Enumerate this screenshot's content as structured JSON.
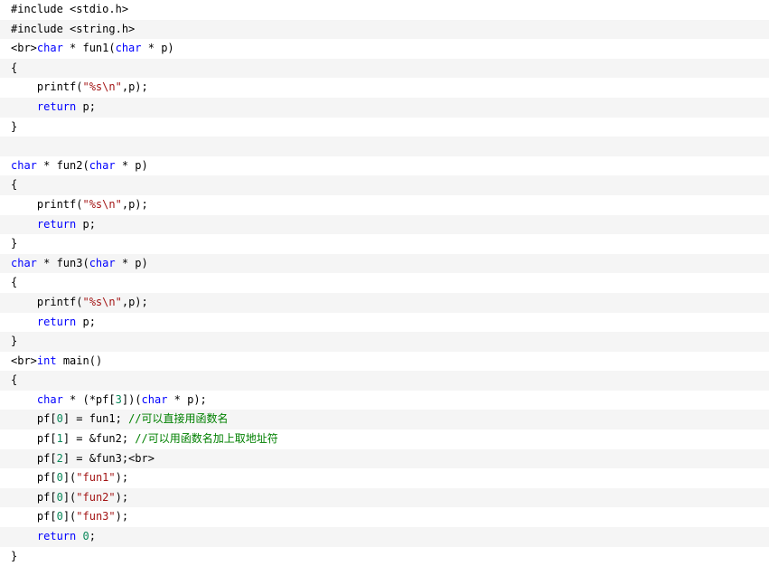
{
  "colors": {
    "background": "#ffffff",
    "stripe": "#f5f5f5",
    "keyword": "#0000ff",
    "string": "#a31515",
    "number": "#09885a",
    "comment": "#008000",
    "plain": "#000000"
  },
  "code": {
    "lines": [
      [
        {
          "t": "plain",
          "v": "#include <stdio.h>"
        }
      ],
      [
        {
          "t": "plain",
          "v": "#include <string.h>"
        }
      ],
      [
        {
          "t": "plain",
          "v": "<br>"
        },
        {
          "t": "kw",
          "v": "char"
        },
        {
          "t": "plain",
          "v": " * fun1("
        },
        {
          "t": "kw",
          "v": "char"
        },
        {
          "t": "plain",
          "v": " * p)"
        }
      ],
      [
        {
          "t": "plain",
          "v": "{"
        }
      ],
      [
        {
          "t": "plain",
          "v": "    printf("
        },
        {
          "t": "str",
          "v": "\"%s\\n\""
        },
        {
          "t": "plain",
          "v": ",p);"
        }
      ],
      [
        {
          "t": "plain",
          "v": "    "
        },
        {
          "t": "kw",
          "v": "return"
        },
        {
          "t": "plain",
          "v": " p;"
        }
      ],
      [
        {
          "t": "plain",
          "v": "}"
        }
      ],
      [
        {
          "t": "plain",
          "v": ""
        }
      ],
      [
        {
          "t": "kw",
          "v": "char"
        },
        {
          "t": "plain",
          "v": " * fun2("
        },
        {
          "t": "kw",
          "v": "char"
        },
        {
          "t": "plain",
          "v": " * p)"
        }
      ],
      [
        {
          "t": "plain",
          "v": "{"
        }
      ],
      [
        {
          "t": "plain",
          "v": "    printf("
        },
        {
          "t": "str",
          "v": "\"%s\\n\""
        },
        {
          "t": "plain",
          "v": ",p);"
        }
      ],
      [
        {
          "t": "plain",
          "v": "    "
        },
        {
          "t": "kw",
          "v": "return"
        },
        {
          "t": "plain",
          "v": " p;"
        }
      ],
      [
        {
          "t": "plain",
          "v": "}"
        }
      ],
      [
        {
          "t": "kw",
          "v": "char"
        },
        {
          "t": "plain",
          "v": " * fun3("
        },
        {
          "t": "kw",
          "v": "char"
        },
        {
          "t": "plain",
          "v": " * p)"
        }
      ],
      [
        {
          "t": "plain",
          "v": "{"
        }
      ],
      [
        {
          "t": "plain",
          "v": "    printf("
        },
        {
          "t": "str",
          "v": "\"%s\\n\""
        },
        {
          "t": "plain",
          "v": ",p);"
        }
      ],
      [
        {
          "t": "plain",
          "v": "    "
        },
        {
          "t": "kw",
          "v": "return"
        },
        {
          "t": "plain",
          "v": " p;"
        }
      ],
      [
        {
          "t": "plain",
          "v": "}"
        }
      ],
      [
        {
          "t": "plain",
          "v": "<br>"
        },
        {
          "t": "kw",
          "v": "int"
        },
        {
          "t": "plain",
          "v": " main()"
        }
      ],
      [
        {
          "t": "plain",
          "v": "{"
        }
      ],
      [
        {
          "t": "plain",
          "v": "    "
        },
        {
          "t": "kw",
          "v": "char"
        },
        {
          "t": "plain",
          "v": " * (*pf["
        },
        {
          "t": "num",
          "v": "3"
        },
        {
          "t": "plain",
          "v": "])("
        },
        {
          "t": "kw",
          "v": "char"
        },
        {
          "t": "plain",
          "v": " * p);"
        }
      ],
      [
        {
          "t": "plain",
          "v": "    pf["
        },
        {
          "t": "num",
          "v": "0"
        },
        {
          "t": "plain",
          "v": "] = fun1; "
        },
        {
          "t": "cmt",
          "v": "//可以直接用函数名"
        }
      ],
      [
        {
          "t": "plain",
          "v": "    pf["
        },
        {
          "t": "num",
          "v": "1"
        },
        {
          "t": "plain",
          "v": "] = &fun2; "
        },
        {
          "t": "cmt",
          "v": "//可以用函数名加上取地址符"
        }
      ],
      [
        {
          "t": "plain",
          "v": "    pf["
        },
        {
          "t": "num",
          "v": "2"
        },
        {
          "t": "plain",
          "v": "] = &fun3;<br>"
        }
      ],
      [
        {
          "t": "plain",
          "v": "    pf["
        },
        {
          "t": "num",
          "v": "0"
        },
        {
          "t": "plain",
          "v": "]("
        },
        {
          "t": "str",
          "v": "\"fun1\""
        },
        {
          "t": "plain",
          "v": ");"
        }
      ],
      [
        {
          "t": "plain",
          "v": "    pf["
        },
        {
          "t": "num",
          "v": "0"
        },
        {
          "t": "plain",
          "v": "]("
        },
        {
          "t": "str",
          "v": "\"fun2\""
        },
        {
          "t": "plain",
          "v": ");"
        }
      ],
      [
        {
          "t": "plain",
          "v": "    pf["
        },
        {
          "t": "num",
          "v": "0"
        },
        {
          "t": "plain",
          "v": "]("
        },
        {
          "t": "str",
          "v": "\"fun3\""
        },
        {
          "t": "plain",
          "v": ");"
        }
      ],
      [
        {
          "t": "plain",
          "v": "    "
        },
        {
          "t": "kw",
          "v": "return"
        },
        {
          "t": "plain",
          "v": " "
        },
        {
          "t": "num",
          "v": "0"
        },
        {
          "t": "plain",
          "v": ";"
        }
      ],
      [
        {
          "t": "plain",
          "v": "}"
        }
      ]
    ]
  }
}
